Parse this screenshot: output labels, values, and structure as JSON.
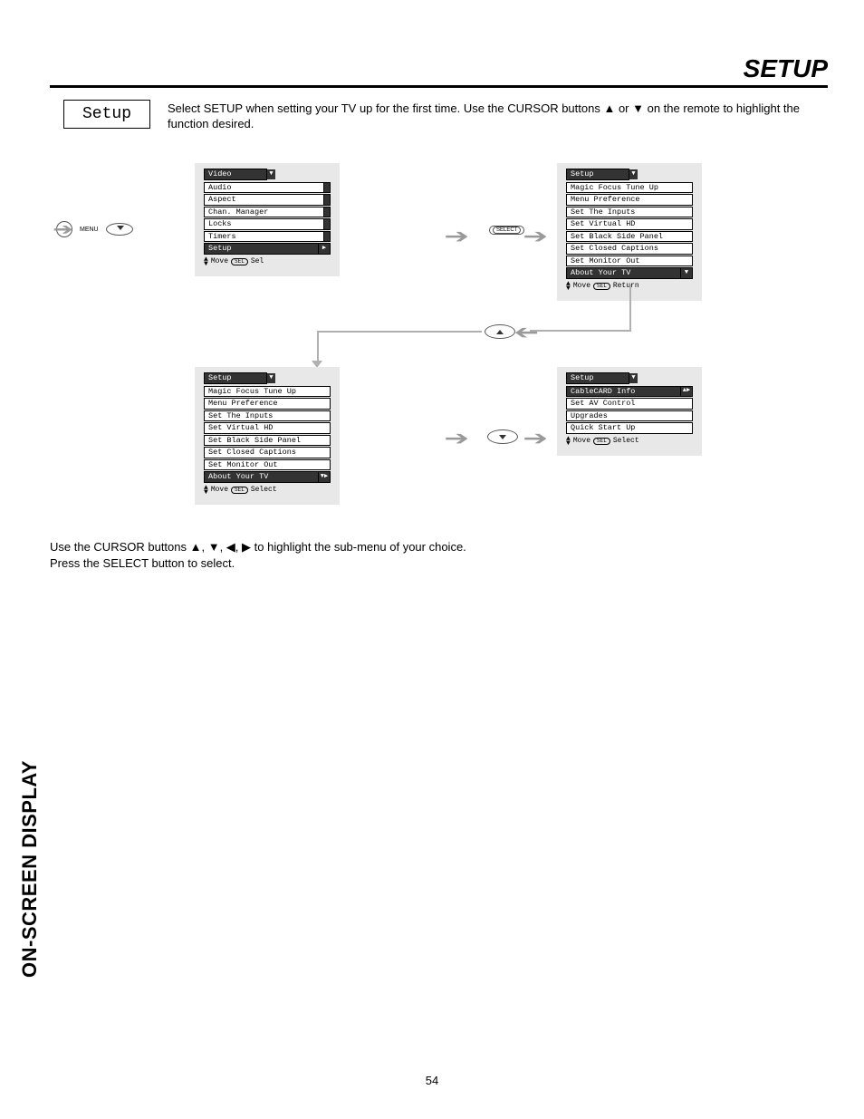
{
  "header": {
    "title": "SETUP"
  },
  "section_box": {
    "label": "Setup"
  },
  "intro": {
    "line1_a": "Select SETUP when setting your TV up for the first time.  Use the CURSOR buttons ",
    "up": "▲",
    "or": " or ",
    "down": "▼",
    "line1_b": " on the remote to highlight the function desired."
  },
  "remote": {
    "menu_label": "MENU"
  },
  "select_pill": {
    "label": "SELECT"
  },
  "osd1": {
    "title": "Video",
    "items": [
      {
        "label": "Audio",
        "hl": false,
        "cap": "end"
      },
      {
        "label": "Aspect",
        "hl": false,
        "cap": "end"
      },
      {
        "label": "Chan. Manager",
        "hl": false,
        "cap": "end"
      },
      {
        "label": "Locks",
        "hl": false,
        "cap": "end"
      },
      {
        "label": "Timers",
        "hl": false,
        "cap": "end"
      },
      {
        "label": "Setup",
        "hl": true,
        "cap": "tri",
        "tri": "▶"
      }
    ],
    "hint": {
      "move": "Move",
      "btn": "SEL",
      "action": "Sel"
    }
  },
  "osd2": {
    "title": "Setup",
    "items": [
      {
        "label": "Magic Focus Tune Up",
        "hl": false
      },
      {
        "label": "Menu Preference",
        "hl": false
      },
      {
        "label": "Set The Inputs",
        "hl": false
      },
      {
        "label": "Set Virtual HD",
        "hl": false
      },
      {
        "label": "Set Black Side Panel",
        "hl": false
      },
      {
        "label": "Set Closed Captions",
        "hl": false
      },
      {
        "label": "Set Monitor Out",
        "hl": false
      },
      {
        "label": "About Your TV",
        "hl": true,
        "cap": "tri",
        "tri": "▼"
      }
    ],
    "hint": {
      "move": "Move",
      "btn": "SEL",
      "action": "Return"
    }
  },
  "osd3": {
    "title": "Setup",
    "items": [
      {
        "label": "Magic Focus Tune Up",
        "hl": false
      },
      {
        "label": "Menu Preference",
        "hl": false
      },
      {
        "label": "Set The Inputs",
        "hl": false
      },
      {
        "label": "Set Virtual HD",
        "hl": false
      },
      {
        "label": "Set Black Side Panel",
        "hl": false
      },
      {
        "label": "Set Closed Captions",
        "hl": false
      },
      {
        "label": "Set Monitor Out",
        "hl": false
      },
      {
        "label": "About Your TV",
        "hl": true,
        "cap": "tri",
        "tri": "▼▶"
      }
    ],
    "hint": {
      "move": "Move",
      "btn": "SEL",
      "action": "Select"
    }
  },
  "osd4": {
    "title": "Setup",
    "items": [
      {
        "label": "CableCARD Info",
        "hl": true,
        "cap": "tri",
        "tri": "▲▶"
      },
      {
        "label": "Set AV Control",
        "hl": false
      },
      {
        "label": "Upgrades",
        "hl": false
      },
      {
        "label": "Quick Start Up",
        "hl": false
      }
    ],
    "hint": {
      "move": "Move",
      "btn": "SEL",
      "action": "Select"
    }
  },
  "bottom": {
    "line1_a": "Use the CURSOR buttons ",
    "arrows": "▲, ▼, ◀, ▶",
    "line1_b": " to highlight the sub-menu of your choice.",
    "line2": "Press the SELECT button to select."
  },
  "side_label": {
    "text": "ON-SCREEN DISPLAY"
  },
  "page_number": "54"
}
